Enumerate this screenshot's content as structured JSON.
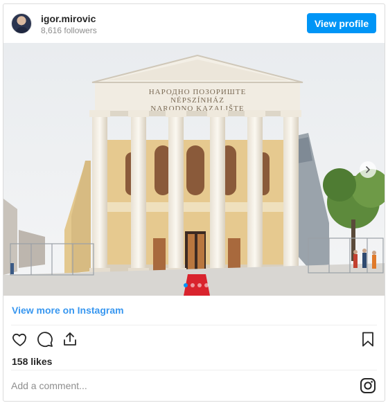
{
  "header": {
    "username": "igor.mirovic",
    "followers": "8,616 followers",
    "view_profile_label": "View profile"
  },
  "media": {
    "building_inscription": [
      "НАРОДНО ПОЗОРИШТЕ",
      "NÉPSZÍNHÁZ",
      "NARODNO KAZALIŠTE"
    ],
    "carousel_total": 4,
    "carousel_active": 1
  },
  "links": {
    "view_more": "View more on Instagram"
  },
  "engagement": {
    "likes": "158 likes"
  },
  "comment": {
    "placeholder": "Add a comment..."
  },
  "icons": {
    "like": "heart-icon",
    "comment": "comment-icon",
    "share": "share-icon",
    "save": "bookmark-icon",
    "brand": "instagram-icon",
    "next": "chevron-right-icon"
  },
  "colors": {
    "accent": "#0095f6",
    "link": "#3897f0",
    "muted": "#8e8e8e",
    "border": "#dbdbdb"
  }
}
